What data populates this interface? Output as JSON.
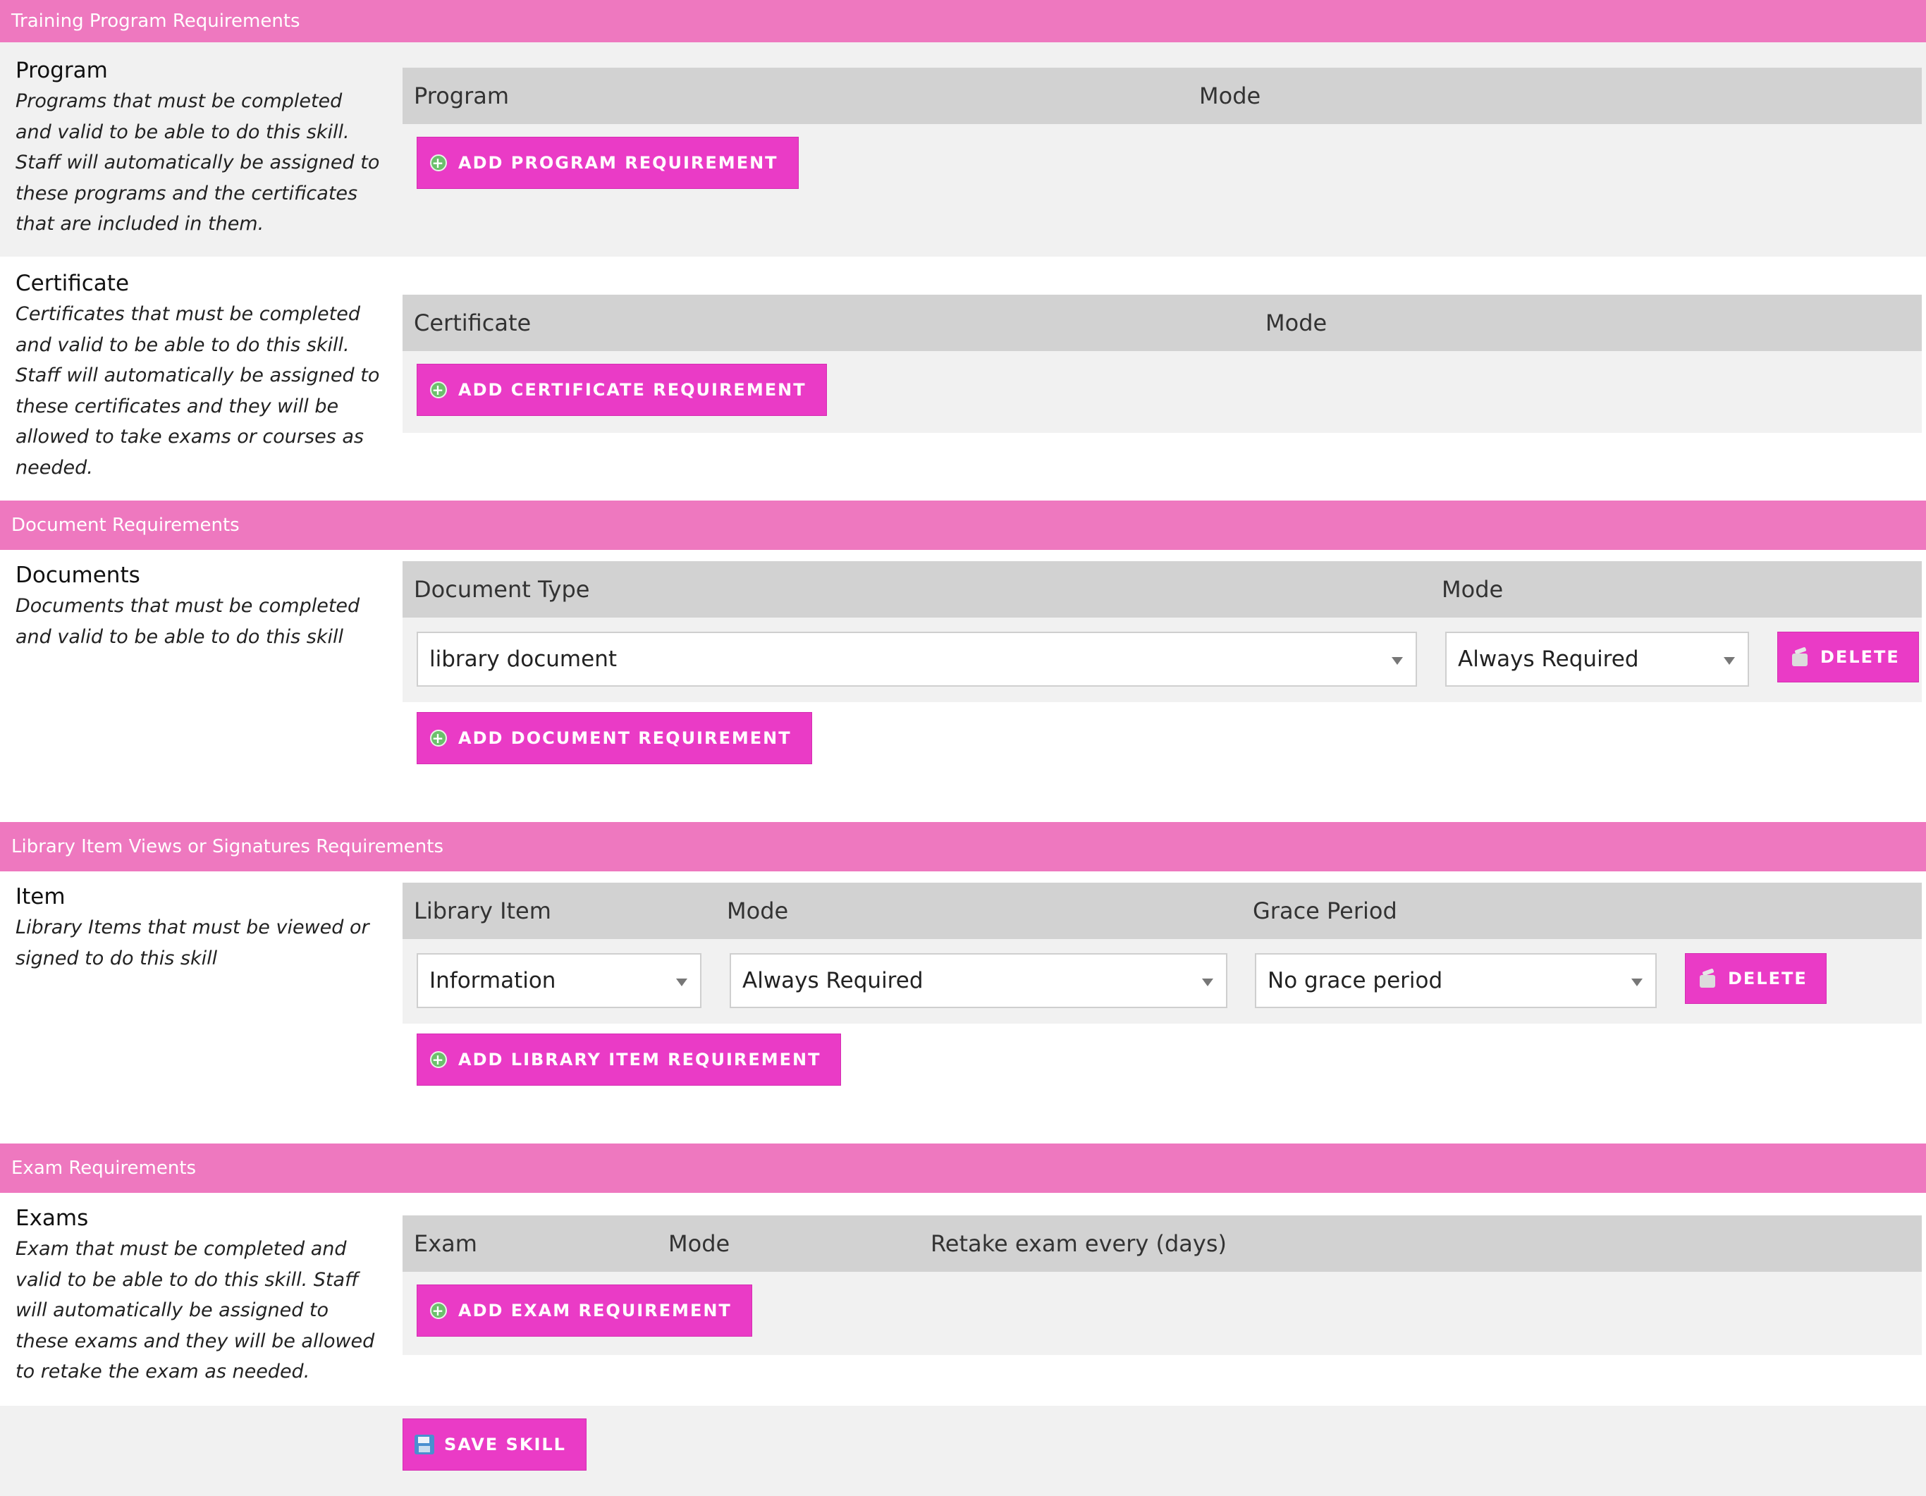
{
  "colors": {
    "header_pink": "#ee78bf",
    "button_pink": "#ea3bc6",
    "table_header_grey": "#d2d2d2",
    "row_grey": "#f1f1f1"
  },
  "icons": {
    "add": "plus-circle-icon",
    "delete": "trash-icon",
    "save": "floppy-disk-icon",
    "dropdown": "chevron-down-icon"
  },
  "training": {
    "header": "Training Program Requirements",
    "program": {
      "title": "Program",
      "description": "Programs that must be completed and valid to be able to do this skill. Staff will automatically be assigned to these programs and the certificates that are included in them.",
      "col_program": "Program",
      "col_mode": "Mode",
      "add_label": "ADD PROGRAM REQUIREMENT"
    },
    "certificate": {
      "title": "Certificate",
      "description": "Certificates that must be completed and valid to be able to do this skill. Staff will automatically be assigned to these certificates and they will be allowed to take exams or courses as needed.",
      "col_certificate": "Certificate",
      "col_mode": "Mode",
      "add_label": "ADD CERTIFICATE REQUIREMENT"
    }
  },
  "documents": {
    "header": "Document Requirements",
    "title": "Documents",
    "description": "Documents that must be completed and valid to be able to do this skill",
    "col_type": "Document Type",
    "col_mode": "Mode",
    "rows": [
      {
        "type": "library document",
        "mode": "Always Required",
        "delete_label": "DELETE"
      }
    ],
    "add_label": "ADD DOCUMENT REQUIREMENT"
  },
  "library": {
    "header": "Library Item Views or Signatures Requirements",
    "title": "Item",
    "description": "Library Items that must be viewed or signed to do this skill",
    "col_item": "Library Item",
    "col_mode": "Mode",
    "col_grace": "Grace Period",
    "rows": [
      {
        "item": "Information",
        "mode": "Always Required",
        "grace": "No grace period",
        "delete_label": "DELETE"
      }
    ],
    "add_label": "ADD LIBRARY ITEM REQUIREMENT"
  },
  "exams": {
    "header": "Exam Requirements",
    "title": "Exams",
    "description": "Exam that must be completed and valid to be able to do this skill. Staff will automatically be assigned to these exams and they will be allowed to retake the exam as needed.",
    "col_exam": "Exam",
    "col_mode": "Mode",
    "col_retake": "Retake exam every (days)",
    "add_label": "ADD EXAM REQUIREMENT"
  },
  "footer": {
    "save_label": "SAVE SKILL"
  }
}
